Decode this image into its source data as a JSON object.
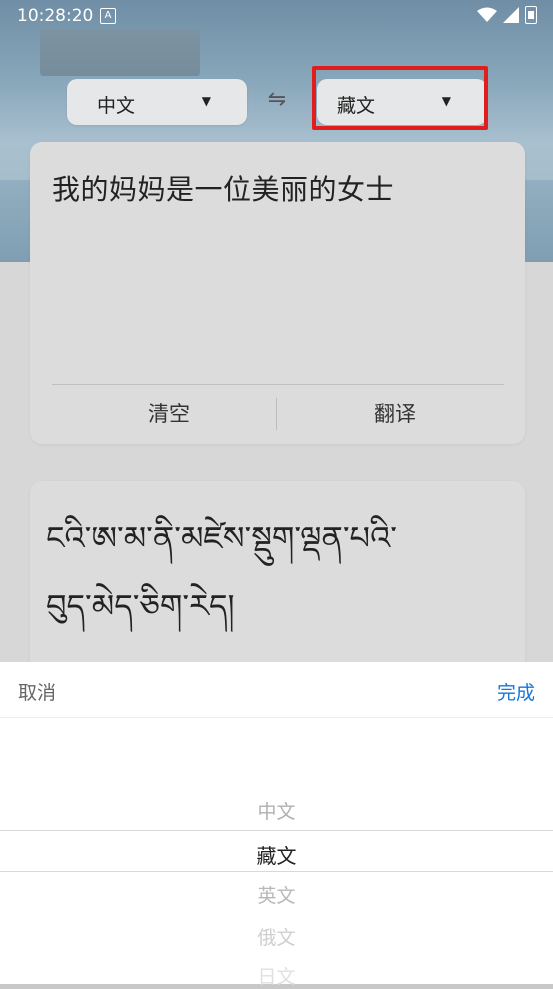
{
  "status": {
    "time": "10:28:20",
    "a_icon": "A",
    "icons": [
      "wifi-icon",
      "signal-icon",
      "battery-icon"
    ]
  },
  "languages": {
    "source": "中文",
    "target": "藏文",
    "swap_symbol": "⇋"
  },
  "input": {
    "text": "我的妈妈是一位美丽的女士",
    "clear_label": "清空",
    "translate_label": "翻译"
  },
  "output": {
    "line1": "ངའི་ཨ་མ་ནི་མཛེས་སྡུག་ལྡན་པའི་",
    "line2": "བུད་མེད་ཅིག་རེད།"
  },
  "picker": {
    "cancel_label": "取消",
    "done_label": "完成",
    "options": [
      "中文",
      "藏文",
      "英文",
      "俄文",
      "日文"
    ],
    "selected": "藏文"
  },
  "colors": {
    "accent": "#1677d9",
    "highlight": "#e01e1e"
  }
}
